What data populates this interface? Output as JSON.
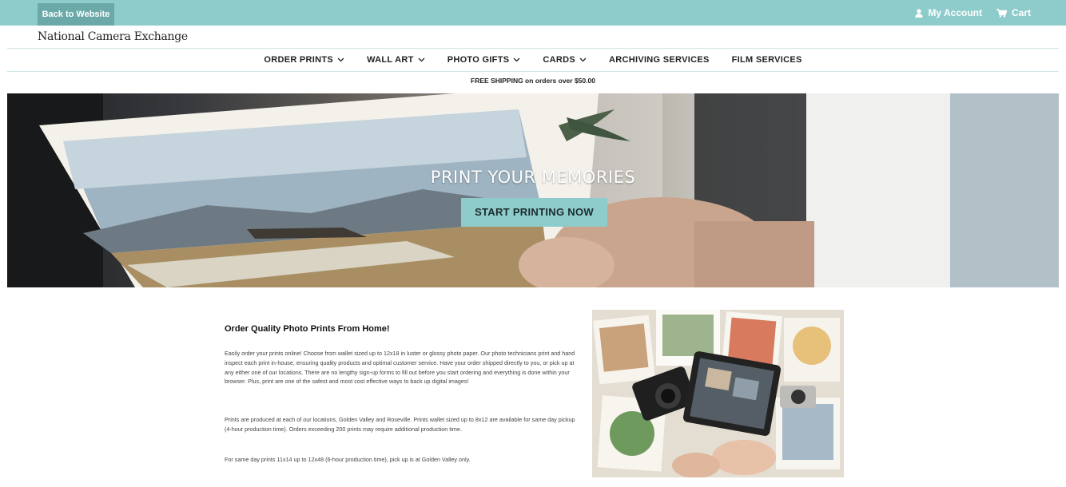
{
  "topbar": {
    "back_label": "Back to Website",
    "account_label": "My Account",
    "cart_label": "Cart",
    "color": "#8ecccb"
  },
  "brand": "National Camera Exchange",
  "nav": {
    "items": [
      {
        "label": "ORDER PRINTS",
        "dropdown": true
      },
      {
        "label": "WALL ART",
        "dropdown": true
      },
      {
        "label": "PHOTO GIFTS",
        "dropdown": true
      },
      {
        "label": "CARDS",
        "dropdown": true
      },
      {
        "label": "ARCHIVING SERVICES",
        "dropdown": false
      },
      {
        "label": "FILM SERVICES",
        "dropdown": false
      }
    ]
  },
  "shipping_banner": "FREE SHIPPING on orders over $50.00",
  "hero": {
    "title": "PRINT YOUR MEMORIES",
    "button_label": "START PRINTING NOW"
  },
  "content": {
    "title": "Order Quality Photo Prints From Home!",
    "paragraphs": [
      "Easily order your prints online! Choose from wallet sized up to 12x18 in luster or glossy photo paper. Our photo technicians print and hand inspect each print in-house, ensuring quality products and optimal customer service. Have your order shipped directly to you, or pick up at any either one of our locations. There are no lengthy sign-up forms to fill out before you start ordering and everything is done within your browser. Plus, print are one of the safest and most cost effective ways to back up digital images!",
      "Prints are produced at each of our locations, Golden Valley and Roseville. Prints wallet sized up to 8x12 are available for same day pickup (4-hour production time). Orders exceeding 200 prints may require additional production time.",
      "For same day prints 11x14 up to 12x48 (6-hour production time), pick up is at Golden Valley only."
    ]
  }
}
